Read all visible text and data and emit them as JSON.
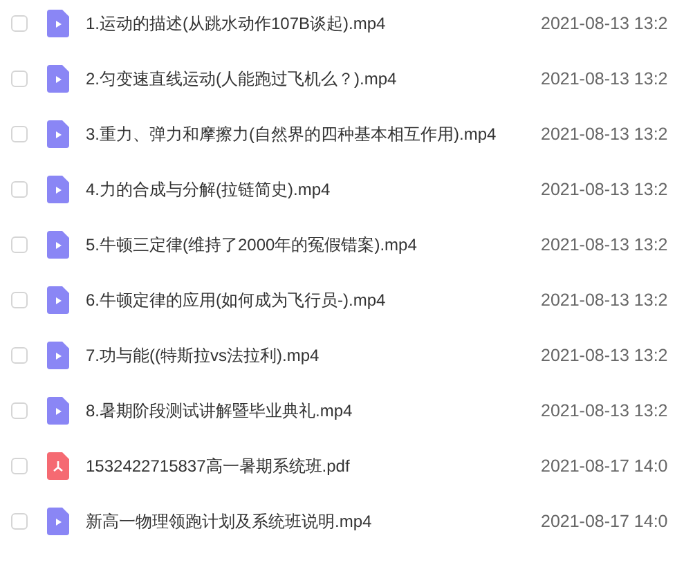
{
  "files": [
    {
      "kind": "video",
      "checked": false,
      "name": "1.运动的描述(从跳水动作107B谈起).mp4",
      "date": "2021-08-13 13:2"
    },
    {
      "kind": "video",
      "checked": false,
      "name": "2.匀变速直线运动(人能跑过飞机么？).mp4",
      "date": "2021-08-13 13:2"
    },
    {
      "kind": "video",
      "checked": false,
      "name": "3.重力、弹力和摩擦力(自然界的四种基本相互作用).mp4",
      "date": "2021-08-13 13:2"
    },
    {
      "kind": "video",
      "checked": false,
      "name": "4.力的合成与分解(拉链简史).mp4",
      "date": "2021-08-13 13:2"
    },
    {
      "kind": "video",
      "checked": false,
      "name": "5.牛顿三定律(维持了2000年的冤假错案).mp4",
      "date": "2021-08-13 13:2"
    },
    {
      "kind": "video",
      "checked": false,
      "name": "6.牛顿定律的应用(如何成为飞行员-).mp4",
      "date": "2021-08-13 13:2"
    },
    {
      "kind": "video",
      "checked": false,
      "name": "7.功与能((特斯拉vs法拉利).mp4",
      "date": "2021-08-13 13:2"
    },
    {
      "kind": "video",
      "checked": false,
      "name": "8.暑期阶段测试讲解暨毕业典礼.mp4",
      "date": "2021-08-13 13:2"
    },
    {
      "kind": "pdf",
      "checked": false,
      "name": "1532422715837高一暑期系统班.pdf",
      "date": "2021-08-17 14:0"
    },
    {
      "kind": "video",
      "checked": false,
      "name": "新高一物理领跑计划及系统班说明.mp4",
      "date": "2021-08-17 14:0"
    }
  ]
}
